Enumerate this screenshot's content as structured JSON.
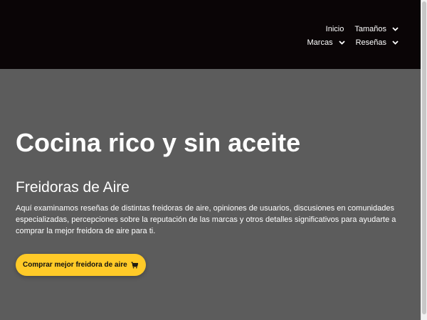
{
  "nav": {
    "row1": [
      {
        "label": "Inicio",
        "has_dropdown": false
      },
      {
        "label": "Tamaños",
        "has_dropdown": true
      }
    ],
    "row2": [
      {
        "label": "Marcas",
        "has_dropdown": true
      },
      {
        "label": "Reseñas",
        "has_dropdown": true
      }
    ]
  },
  "hero": {
    "title": "Cocina rico y sin aceite",
    "subtitle": "Freidoras de Aire",
    "description": "Aquí examinamos reseñas de distintas freidoras de aire, opiniones de usuarios, discusiones en comunidades especializadas, percepciones sobre la reputación de las marcas y otros detalles significativos para ayudarte a comprar la mejor freidora de aire para ti.",
    "cta_label": "Comprar mejor freidora de aire",
    "cta_icon": "shopping-cart-icon"
  },
  "colors": {
    "header_bg": "#0a0506",
    "hero_bg": "#5c5c5c",
    "accent": "#ffca28",
    "text": "#ffffff"
  }
}
